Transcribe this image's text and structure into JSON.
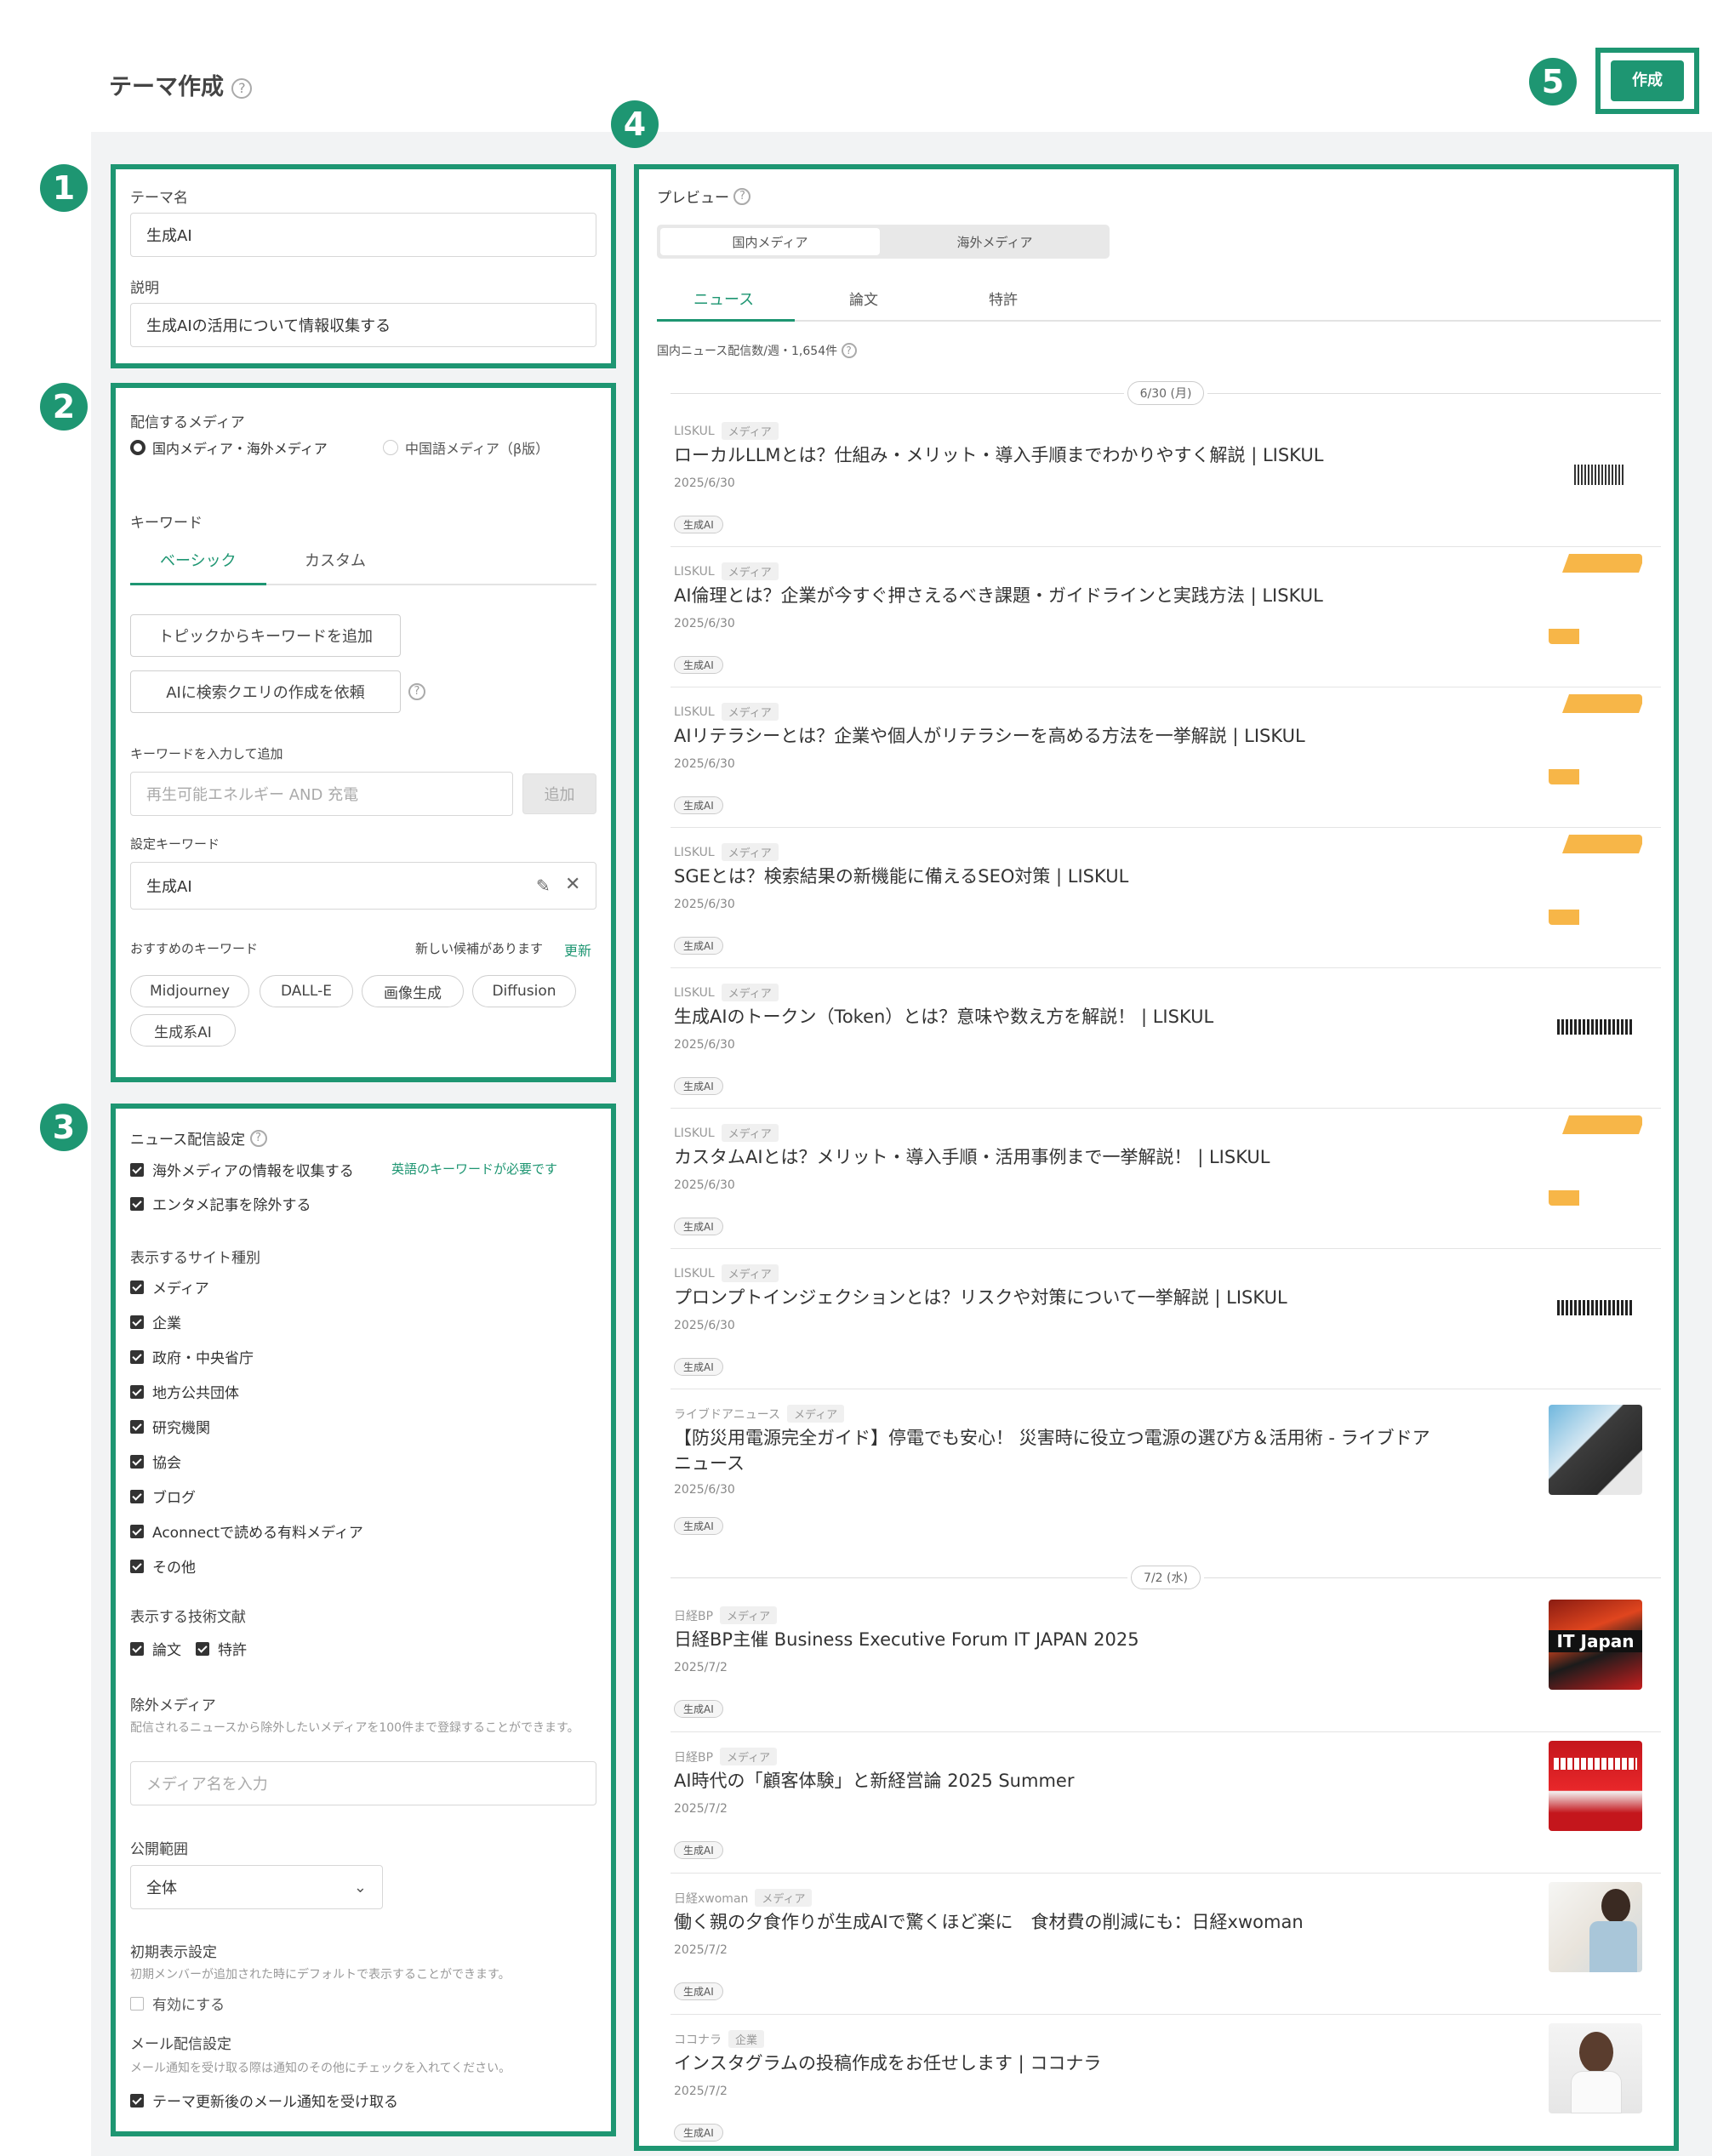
{
  "header": {
    "title": "テーマ作成",
    "help": "?",
    "create_label": "作成"
  },
  "badges": [
    "1",
    "2",
    "3",
    "4",
    "5"
  ],
  "theme": {
    "name_label": "テーマ名",
    "name_value": "生成AI",
    "desc_label": "説明",
    "desc_value": "生成AIの活用について情報収集する"
  },
  "media": {
    "label": "配信するメディア",
    "options": [
      "国内メディア・海外メディア",
      "中国語メディア（β版）"
    ],
    "keyword_label": "キーワード",
    "tabs": [
      "ベーシック",
      "カスタム"
    ],
    "topic_btn": "トピックからキーワードを追加",
    "ai_btn": "AIに検索クエリの作成を依頼",
    "add_label": "キーワードを入力して追加",
    "add_placeholder": "再生可能エネルギー AND 充電",
    "add_btn": "追加",
    "set_label": "設定キーワード",
    "set_value": "生成AI",
    "rec_label": "おすすめのキーワード",
    "rec_notice": "新しい候補があります",
    "rec_refresh": "更新",
    "chips": [
      "Midjourney",
      "DALL-E",
      "画像生成",
      "Diffusion",
      "生成系AI"
    ]
  },
  "news_settings": {
    "label": "ニュース配信設定",
    "overseas": "海外メディアの情報を収集する",
    "overseas_note": "英語のキーワードが必要です",
    "exclude_ent": "エンタメ記事を除外する",
    "site_label": "表示するサイト種別",
    "sites": [
      "メディア",
      "企業",
      "政府・中央省庁",
      "地方公共団体",
      "研究機関",
      "協会",
      "ブログ",
      "Aconnectで読める有料メディア",
      "その他"
    ],
    "tech_label": "表示する技術文献",
    "tech": [
      "論文",
      "特許"
    ],
    "exclude_label": "除外メディア",
    "exclude_desc": "配信されるニュースから除外したいメディアを100件まで登録することができます。",
    "exclude_placeholder": "メディア名を入力",
    "scope_label": "公開範囲",
    "scope_value": "全体",
    "initial_label": "初期表示設定",
    "initial_desc": "初期メンバーが追加された時にデフォルトで表示することができます。",
    "initial_check": "有効にする",
    "mail_label": "メール配信設定",
    "mail_desc": "メール通知を受け取る際は通知のその他にチェックを入れてください。",
    "mail_check": "テーマ更新後のメール通知を受け取る"
  },
  "preview": {
    "label": "プレビュー",
    "seg": [
      "国内メディア",
      "海外メディア"
    ],
    "tabs": [
      "ニュース",
      "論文",
      "特許"
    ],
    "count": "国内ニュース配信数/週・1,654件",
    "date1": "6/30 (月)",
    "date2": "7/2 (水)",
    "items": [
      {
        "src": "LISKUL",
        "tag": "メディア",
        "title": "ローカルLLMとは？仕組み・メリット・導入手順までわかりやすく解説 | LISKUL",
        "date": "2025/6/30",
        "genre": "生成AI"
      },
      {
        "src": "LISKUL",
        "tag": "メディア",
        "title": "AI倫理とは？企業が今すぐ押さえるべき課題・ガイドラインと実践方法 | LISKUL",
        "date": "2025/6/30",
        "genre": "生成AI"
      },
      {
        "src": "LISKUL",
        "tag": "メディア",
        "title": "AIリテラシーとは？企業や個人がリテラシーを高める方法を一挙解説 | LISKUL",
        "date": "2025/6/30",
        "genre": "生成AI"
      },
      {
        "src": "LISKUL",
        "tag": "メディア",
        "title": "SGEとは？検索結果の新機能に備えるSEO対策 | LISKUL",
        "date": "2025/6/30",
        "genre": "生成AI"
      },
      {
        "src": "LISKUL",
        "tag": "メディア",
        "title": "生成AIのトークン（Token）とは？意味や数え方を解説！ | LISKUL",
        "date": "2025/6/30",
        "genre": "生成AI"
      },
      {
        "src": "LISKUL",
        "tag": "メディア",
        "title": "カスタムAIとは？メリット・導入手順・活用事例まで一挙解説！ | LISKUL",
        "date": "2025/6/30",
        "genre": "生成AI"
      },
      {
        "src": "LISKUL",
        "tag": "メディア",
        "title": "プロンプトインジェクションとは？リスクや対策について一挙解説 | LISKUL",
        "date": "2025/6/30",
        "genre": "生成AI"
      },
      {
        "src": "ライブドアニュース",
        "tag": "メディア",
        "title": "【防災用電源完全ガイド】停電でも安心！ 災害時に役立つ電源の選び方＆活用術 - ライブドア",
        "title2": "ニュース",
        "date": "2025/6/30",
        "genre": "生成AI"
      },
      {
        "src": "日経BP",
        "tag": "メディア",
        "title": "日経BP主催 Business Executive Forum IT JAPAN 2025",
        "date": "2025/7/2",
        "genre": "生成AI"
      },
      {
        "src": "日経BP",
        "tag": "メディア",
        "title": "AI時代の「顧客体験」と新経営論 2025 Summer",
        "date": "2025/7/2",
        "genre": "生成AI"
      },
      {
        "src": "日経xwoman",
        "tag": "メディア",
        "title": "働く親の夕食作りが生成AIで驚くほど楽に　食材費の削減にも：日経xwoman",
        "date": "2025/7/2",
        "genre": "生成AI"
      },
      {
        "src": "ココナラ",
        "tag": "企業",
        "title": "インスタグラムの投稿作成をお任せします | ココナラ",
        "date": "2025/7/2",
        "genre": "生成AI"
      }
    ]
  },
  "colors": {
    "accent": "#1e9672",
    "bg": "#f2f3f4"
  }
}
